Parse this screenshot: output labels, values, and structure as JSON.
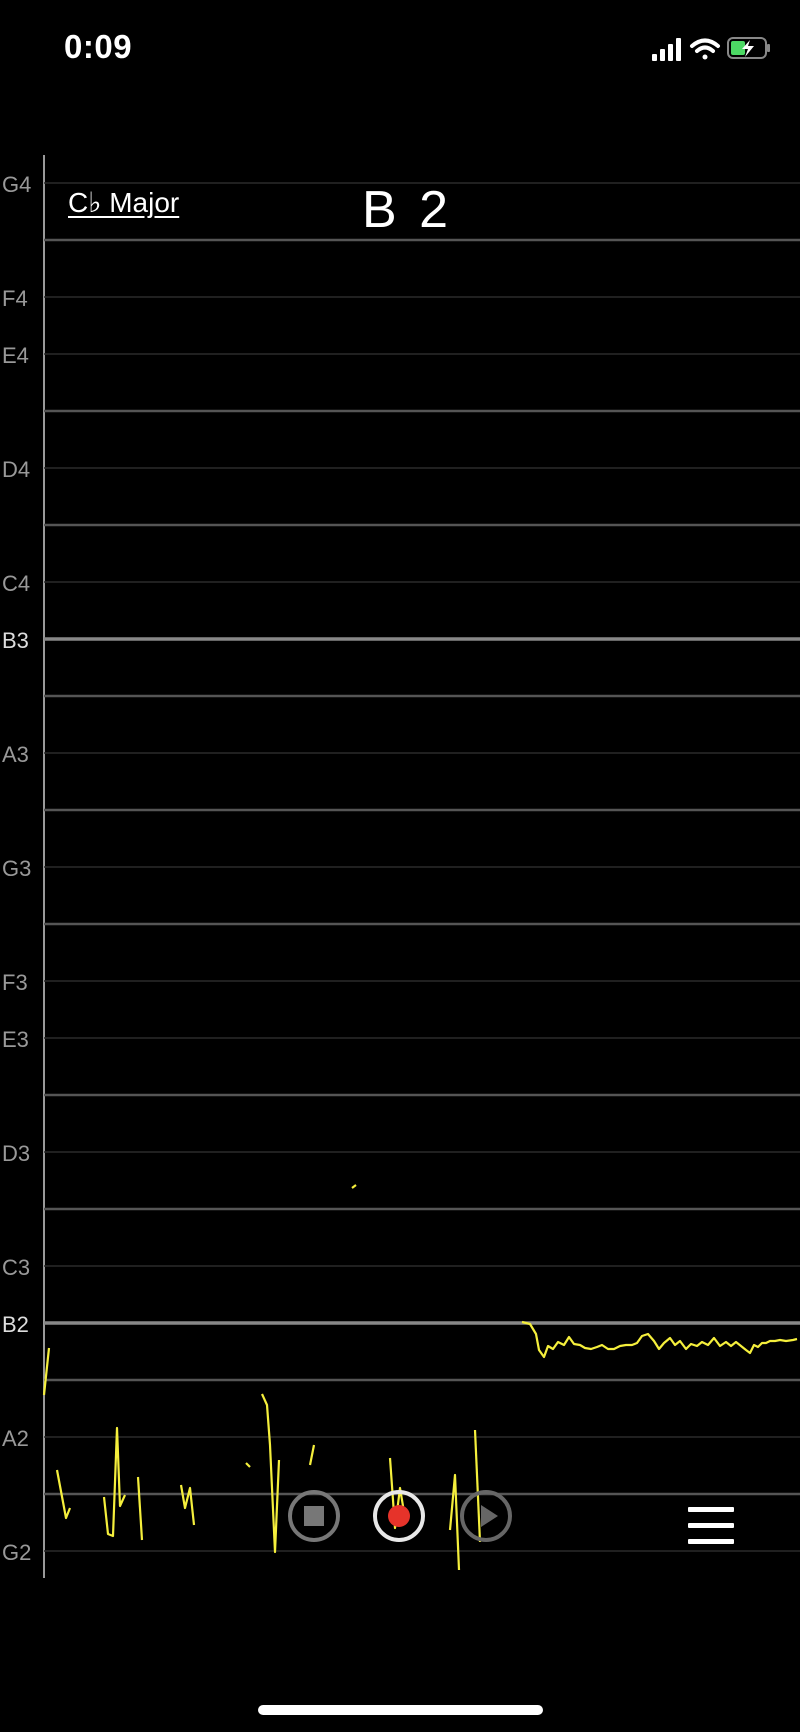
{
  "status_bar": {
    "time": "0:09",
    "signal_icon": "cellular-signal-icon",
    "wifi_icon": "wifi-icon",
    "battery_icon": "battery-charging-icon"
  },
  "header": {
    "key": "C♭ Major",
    "current_note": "B 2"
  },
  "staff": {
    "notes_top_to_bottom": [
      "G4",
      "F4",
      "E4",
      "D4",
      "C4",
      "B3",
      "A3",
      "G3",
      "F3",
      "E3",
      "D3",
      "C3",
      "B2",
      "A2",
      "G2"
    ],
    "note_labels_shown": [
      "G4",
      "F4",
      "E4",
      "D4",
      "C4",
      "B3",
      "A3",
      "G3",
      "F3",
      "E3",
      "D3",
      "C3",
      "B2",
      "A2",
      "G2"
    ],
    "highlighted_notes": [
      "B3",
      "B2"
    ],
    "trace_color": "#f5ef3c"
  },
  "controls": {
    "stop_icon": "stop-icon",
    "record_icon": "record-icon",
    "play_icon": "play-icon",
    "menu_icon": "menu-icon"
  },
  "colors": {
    "background": "#000000",
    "record_red": "#e6332a",
    "pitch_trace": "#f5ef3c"
  }
}
